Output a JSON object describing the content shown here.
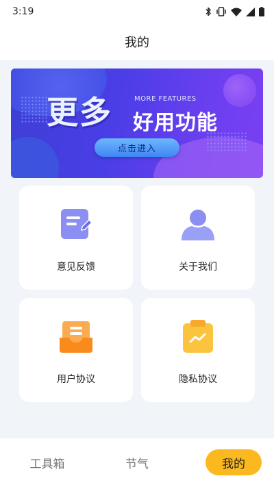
{
  "status_bar": {
    "time": "3:19",
    "icons": [
      "bluetooth-icon",
      "vibrate-icon",
      "wifi-icon",
      "cellular-signal-icon",
      "battery-icon"
    ]
  },
  "header": {
    "title": "我的"
  },
  "banner": {
    "big_text": "更多",
    "subtitle_en": "MORE FEATURES",
    "subtitle_cn": "好用功能",
    "button_label": "点击进入"
  },
  "cards": [
    {
      "label": "意见反馈",
      "icon": "feedback-icon",
      "color": "#8b8ff2"
    },
    {
      "label": "关于我们",
      "icon": "user-icon",
      "color": "#8b8ff2"
    },
    {
      "label": "用户协议",
      "icon": "archive-box-icon",
      "color": "#f98a1c"
    },
    {
      "label": "隐私协议",
      "icon": "clipboard-chart-icon",
      "color": "#fcc43e"
    }
  ],
  "tabbar": {
    "tabs": [
      {
        "label": "工具箱",
        "active": false
      },
      {
        "label": "节气",
        "active": false
      },
      {
        "label": "我的",
        "active": true
      }
    ],
    "active_color": "#fbb81f"
  }
}
